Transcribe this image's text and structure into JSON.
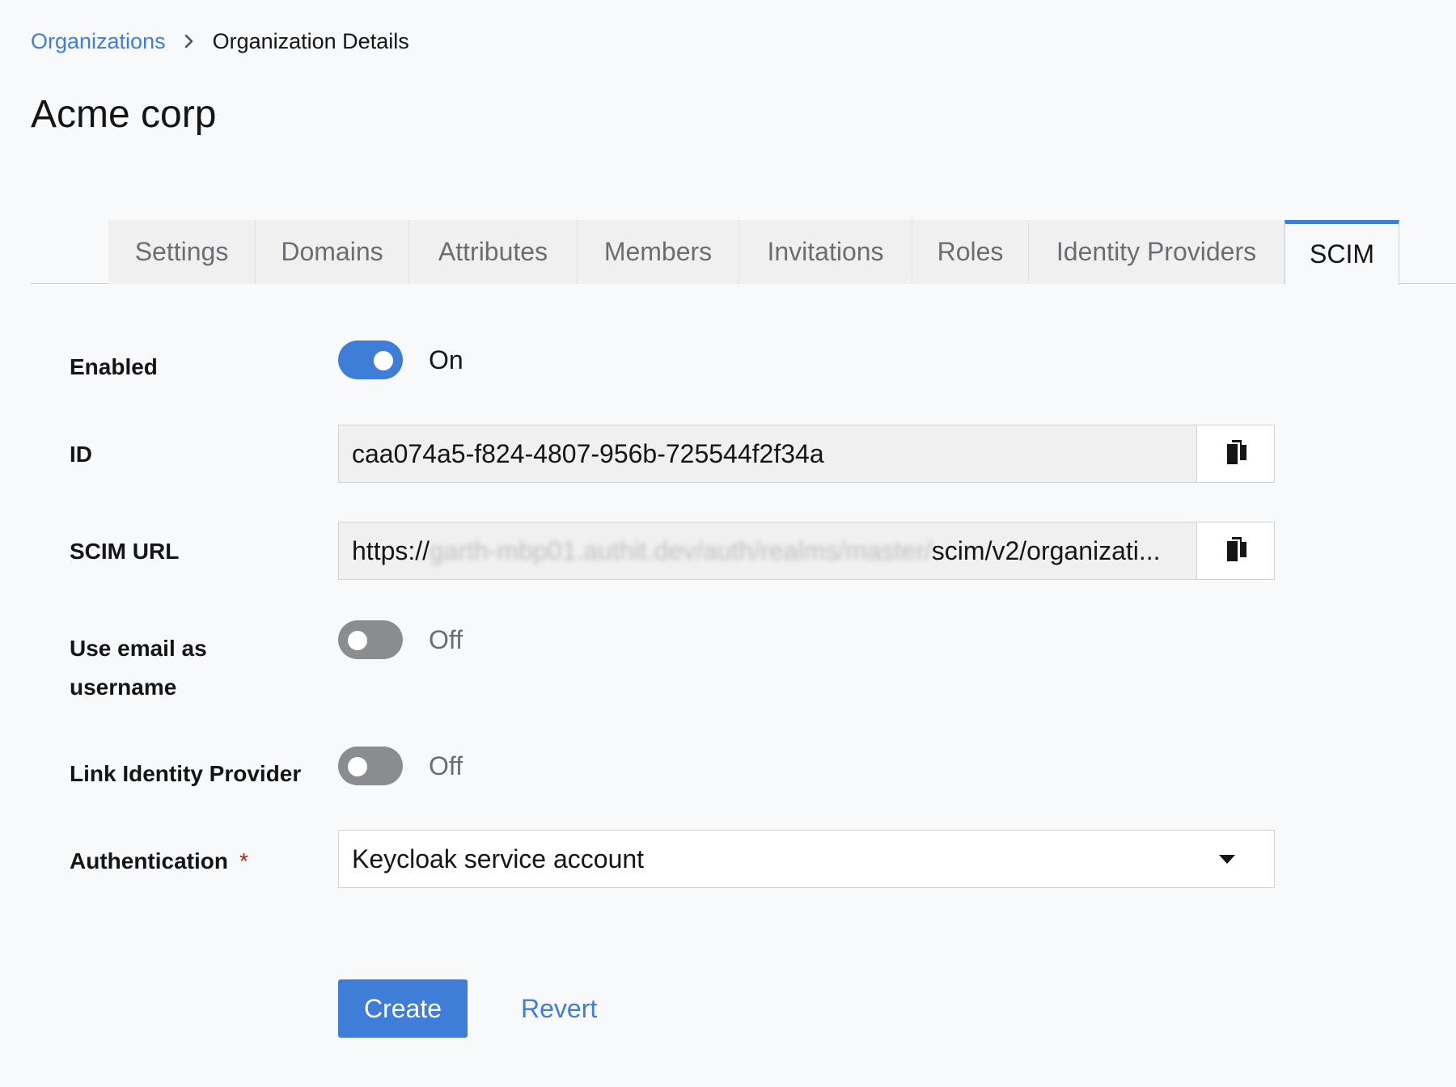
{
  "breadcrumb": {
    "parent": "Organizations",
    "current": "Organization Details"
  },
  "page": {
    "title": "Acme corp"
  },
  "tabs": [
    {
      "label": "Settings",
      "active": false
    },
    {
      "label": "Domains",
      "active": false
    },
    {
      "label": "Attributes",
      "active": false
    },
    {
      "label": "Members",
      "active": false
    },
    {
      "label": "Invitations",
      "active": false
    },
    {
      "label": "Roles",
      "active": false
    },
    {
      "label": "Identity Providers",
      "active": false
    },
    {
      "label": "SCIM",
      "active": true
    }
  ],
  "form": {
    "enabled": {
      "label": "Enabled",
      "state": "On",
      "value": true
    },
    "id": {
      "label": "ID",
      "value": "caa074a5-f824-4807-956b-725544f2f34a"
    },
    "scim_url": {
      "label": "SCIM URL",
      "value_start": "https://",
      "value_redacted": "garth-mbp01.authit.dev/auth/realms/master/",
      "value_end": "scim/v2/organizati..."
    },
    "use_email": {
      "label_line1": "Use email as",
      "label_line2": "username",
      "state": "Off",
      "value": false
    },
    "link_idp": {
      "label": "Link Identity Provider",
      "state": "Off",
      "value": false
    },
    "authentication": {
      "label": "Authentication",
      "required_mark": "*",
      "selected": "Keycloak service account"
    }
  },
  "actions": {
    "create_label": "Create",
    "revert_label": "Revert"
  },
  "colors": {
    "accent": "#3f7ed8",
    "switch_off": "#8a8d90",
    "required": "#c9190b",
    "background": "#f8f9fb"
  },
  "icons": {
    "breadcrumb_separator": "chevron-right-icon",
    "copy": "copy-icon",
    "dropdown": "caret-down-icon"
  }
}
